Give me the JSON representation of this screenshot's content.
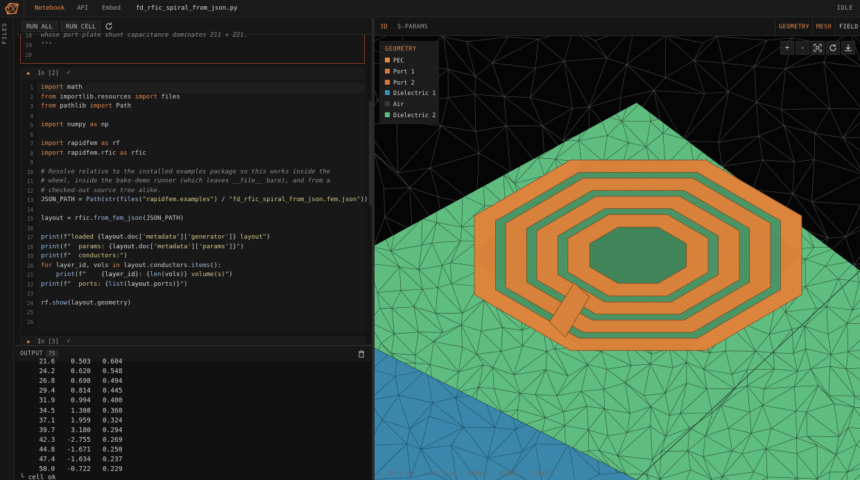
{
  "topbar": {
    "nav": [
      "Notebook",
      "API",
      "Embed"
    ],
    "filename": "fd_rfic_spiral_from_json.py",
    "status": "IDLE"
  },
  "rail": {
    "label": "FILES"
  },
  "toolbar": {
    "run_all": "RUN ALL",
    "run_cell": "RUN CELL"
  },
  "prev_cell": {
    "lines": [
      {
        "n": "18",
        "text": "whose port-plate shunt capacitance dominates Z11 + Z21."
      },
      {
        "n": "19",
        "text": "\"\"\""
      },
      {
        "n": "20",
        "text": ""
      }
    ]
  },
  "cell2": {
    "prompt": "In [2]",
    "status_icon": "✓",
    "lines": [
      {
        "n": "1",
        "html": "<span class='kw'>import</span> math"
      },
      {
        "n": "2",
        "html": "<span class='kw'>from</span> importlib.resources <span class='kw'>import</span> files"
      },
      {
        "n": "3",
        "html": "<span class='kw'>from</span> pathlib <span class='kw'>import</span> Path"
      },
      {
        "n": "4",
        "html": ""
      },
      {
        "n": "5",
        "html": "<span class='kw'>import</span> numpy <span class='kw'>as</span> np"
      },
      {
        "n": "6",
        "html": ""
      },
      {
        "n": "7",
        "html": "<span class='kw'>import</span> rapidfem <span class='kw'>as</span> rf"
      },
      {
        "n": "8",
        "html": "<span class='kw'>import</span> rapidfem.rfic <span class='kw'>as</span> rfic"
      },
      {
        "n": "9",
        "html": ""
      },
      {
        "n": "10",
        "html": "<span class='cm'># Resolve relative to the installed examples package so this works inside the</span>"
      },
      {
        "n": "11",
        "html": "<span class='cm'># wheel, inside the bake-demo runner (which leaves __file__ bare), and from a</span>"
      },
      {
        "n": "12",
        "html": "<span class='cm'># checked-out source tree alike.</span>"
      },
      {
        "n": "13",
        "html": "JSON_PATH = <span class='fn'>Path</span>(<span class='fn'>str</span>(<span class='fn'>files</span>(<span class='st'>\"rapidfem.examples\"</span>) / <span class='st'>\"fd_rfic_spiral_from_json.fem.json\"</span>))"
      },
      {
        "n": "14",
        "html": ""
      },
      {
        "n": "15",
        "html": "layout = rfic.<span class='fn'>from_fem_json</span>(JSON_PATH)"
      },
      {
        "n": "16",
        "html": ""
      },
      {
        "n": "17",
        "html": "<span class='fn'>print</span>(f<span class='st'>\"loaded </span>{<span class='vr'>layout</span>.doc[<span class='st'>'metadata'</span>][<span class='st'>'generator'</span>]}<span class='st'> layout\"</span>)"
      },
      {
        "n": "18",
        "html": "<span class='fn'>print</span>(f<span class='st'>\"  params: </span>{<span class='vr'>layout</span>.doc[<span class='st'>'metadata'</span>][<span class='st'>'params'</span>]}<span class='st'>\"</span>)"
      },
      {
        "n": "19",
        "html": "<span class='fn'>print</span>(f<span class='st'>\"  conductors:\"</span>)"
      },
      {
        "n": "20",
        "html": "<span class='kw'>for</span> layer_id, vols <span class='kw'>in</span> layout.conductors.<span class='fn'>items</span>():"
      },
      {
        "n": "21",
        "html": "    <span class='fn'>print</span>(f<span class='st'>\"    </span>{<span class='vr'>layer_id</span>}<span class='st'>: </span>{<span class='fn'>len</span>(<span class='vr'>vols</span>)}<span class='st'> volume(s)\"</span>)"
      },
      {
        "n": "22",
        "html": "<span class='fn'>print</span>(f<span class='st'>\"  ports: </span>{<span class='fn'>list</span>(<span class='vr'>layout</span>.ports)}<span class='st'>\"</span>)"
      },
      {
        "n": "23",
        "html": ""
      },
      {
        "n": "24",
        "html": "rf.<span class='fn'>show</span>(layout.geometry)"
      },
      {
        "n": "25",
        "html": ""
      },
      {
        "n": "26",
        "html": ""
      }
    ]
  },
  "cell3": {
    "prompt": "In [3]",
    "status_icon": "✓"
  },
  "output": {
    "label": "OUTPUT",
    "count": "75",
    "rows": [
      [
        "21.6",
        "0.503",
        "0.604"
      ],
      [
        "24.2",
        "0.620",
        "0.548"
      ],
      [
        "26.8",
        "0.698",
        "0.494"
      ],
      [
        "29.4",
        "0.814",
        "0.445"
      ],
      [
        "31.9",
        "0.994",
        "0.400"
      ],
      [
        "34.5",
        "1.308",
        "0.360"
      ],
      [
        "37.1",
        "1.959",
        "0.324"
      ],
      [
        "39.7",
        "3.180",
        "0.294"
      ],
      [
        "42.3",
        "-2.755",
        "0.269"
      ],
      [
        "44.8",
        "-1.671",
        "0.250"
      ],
      [
        "47.4",
        "-1.034",
        "0.237"
      ],
      [
        "50.0",
        "-0.722",
        "0.229"
      ]
    ],
    "footer": "└ cell ok"
  },
  "viewer": {
    "tabs": [
      "3D",
      "S-PARAMS"
    ],
    "right_tabs": [
      "GEOMETRY",
      "MESH",
      "FIELD"
    ],
    "legend_title": "GEOMETRY",
    "legend": [
      {
        "label": "PEC",
        "color": "#e8873f"
      },
      {
        "label": "Port 1",
        "color": "#d7783a"
      },
      {
        "label": "Port 2",
        "color": "#d7783a"
      },
      {
        "label": "Dielectric 1",
        "color": "#3d8fb5"
      },
      {
        "label": "Air",
        "color": "#3a3a3a"
      },
      {
        "label": "Dielectric 2",
        "color": "#5fbf7e"
      }
    ],
    "tools": [
      "+",
      "-",
      "fit-icon",
      "reset-icon",
      "download-icon"
    ],
    "footer": "x -95.2 µm   y 87.5 µm   28600n · 31827t · 11k107"
  }
}
